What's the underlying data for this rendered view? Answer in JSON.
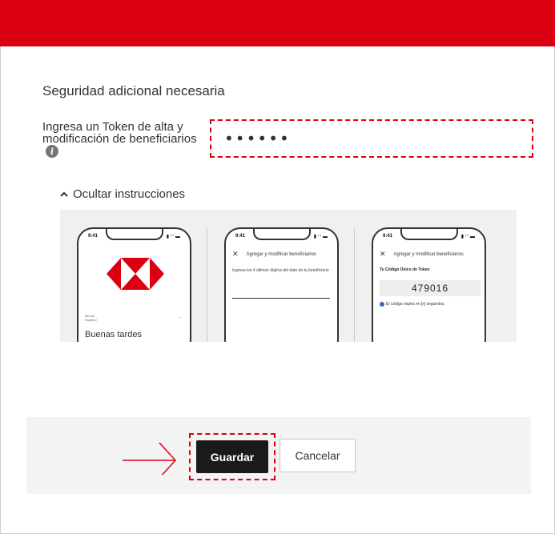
{
  "header": {
    "brand_color": "#db0011"
  },
  "security": {
    "title": "Seguridad adicional necesaria",
    "token_label": "Ingresa un Token de alta y modificación de beneficiarios",
    "token_value": "••••••"
  },
  "instructions": {
    "toggle_label": "Ocultar instrucciones",
    "panel1": {
      "time": "9:41",
      "language": "Idioma",
      "language_value": "Español",
      "greeting": "Buenas tardes"
    },
    "panel2": {
      "time": "9:41",
      "screen_title": "Agregar y modificar beneficiarios",
      "text": "Ingresa los 4 últimos dígitos del dato de tu beneficiario"
    },
    "panel3": {
      "time": "9:41",
      "screen_title": "Agregar y modificar beneficiarios",
      "code_label": "Tu Código Único de Token",
      "code": "479016",
      "note": "El código expira en [x] segundos."
    }
  },
  "footer": {
    "save_label": "Guardar",
    "cancel_label": "Cancelar"
  }
}
